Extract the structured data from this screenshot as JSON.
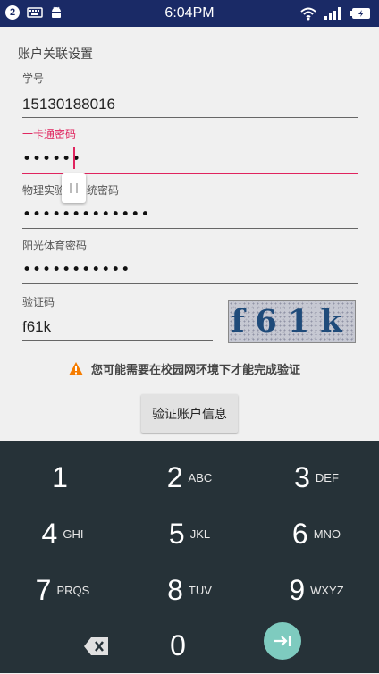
{
  "status_bar": {
    "notification_count": "2",
    "time": "6:04PM"
  },
  "form": {
    "section_title": "账户关联设置",
    "student_id_label": "学号",
    "student_id_value": "15130188016",
    "card_password_label": "一卡通密码",
    "card_password_value": "••••••",
    "physics_password_label": "物理实验课系统密码",
    "physics_password_value": "•••••••••••••",
    "sunshine_pe_label": "阳光体育密码",
    "sunshine_pe_value": "•••••••••••",
    "captcha_label": "验证码",
    "captcha_value": "f61k",
    "captcha_image_text": "f61k",
    "warning_text": "您可能需要在校园网环境下才能完成验证",
    "verify_button": "验证账户信息"
  },
  "keyboard": {
    "keys": [
      {
        "num": "1",
        "letters": ""
      },
      {
        "num": "2",
        "letters": "ABC"
      },
      {
        "num": "3",
        "letters": "DEF"
      },
      {
        "num": "4",
        "letters": "GHI"
      },
      {
        "num": "5",
        "letters": "JKL"
      },
      {
        "num": "6",
        "letters": "MNO"
      },
      {
        "num": "7",
        "letters": "PRQS"
      },
      {
        "num": "8",
        "letters": "TUV"
      },
      {
        "num": "9",
        "letters": "WXYZ"
      },
      {
        "num": "0",
        "letters": ""
      }
    ],
    "delete_icon": "backspace-icon",
    "go_icon": "next-arrow-icon"
  },
  "colors": {
    "status_bar_bg": "#1a2a66",
    "accent": "#e0245e",
    "keyboard_bg": "#263238",
    "go_button": "#7ecbbf",
    "warning": "#f57c00"
  }
}
